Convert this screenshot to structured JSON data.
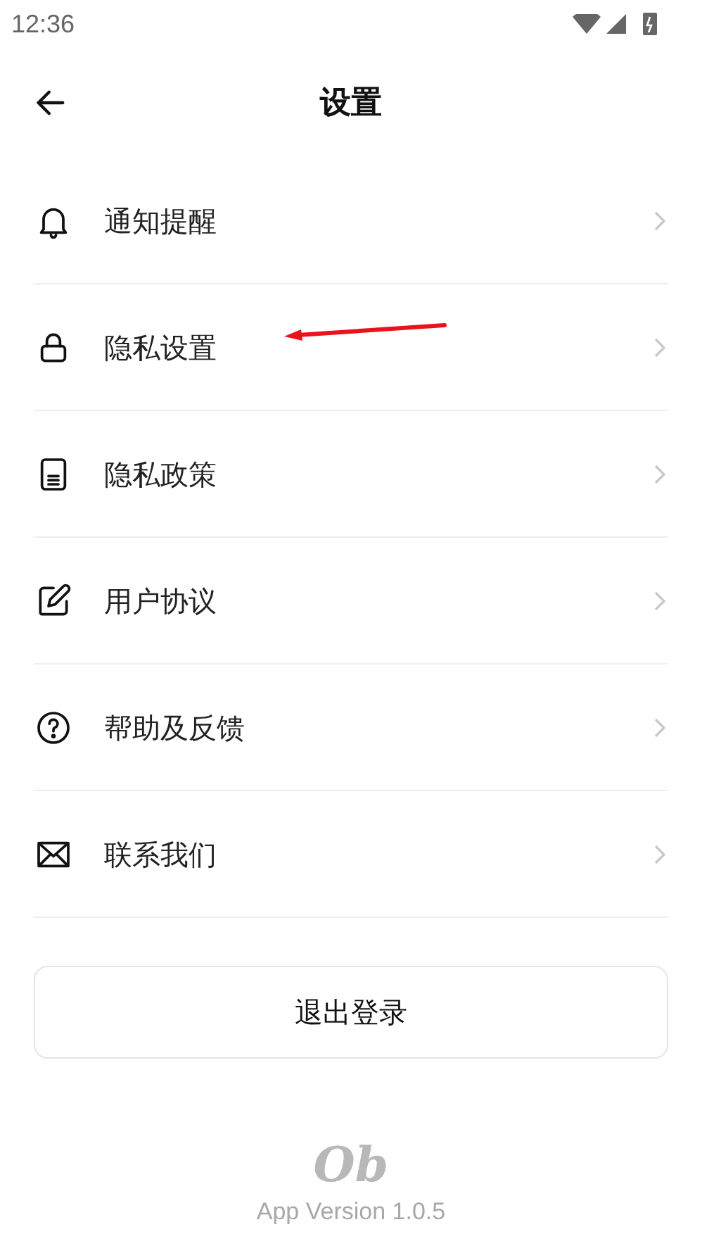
{
  "status_bar": {
    "time": "12:36"
  },
  "header": {
    "title": "设置"
  },
  "items": [
    {
      "kind": "bell",
      "label": "通知提醒"
    },
    {
      "kind": "lock",
      "label": "隐私设置"
    },
    {
      "kind": "document",
      "label": "隐私政策"
    },
    {
      "kind": "pen",
      "label": "用户协议"
    },
    {
      "kind": "help",
      "label": "帮助及反馈"
    },
    {
      "kind": "mail",
      "label": "联系我们"
    }
  ],
  "logout_button": "退出登录",
  "footer": {
    "logo": "Ob",
    "version": "App Version 1.0.5"
  }
}
